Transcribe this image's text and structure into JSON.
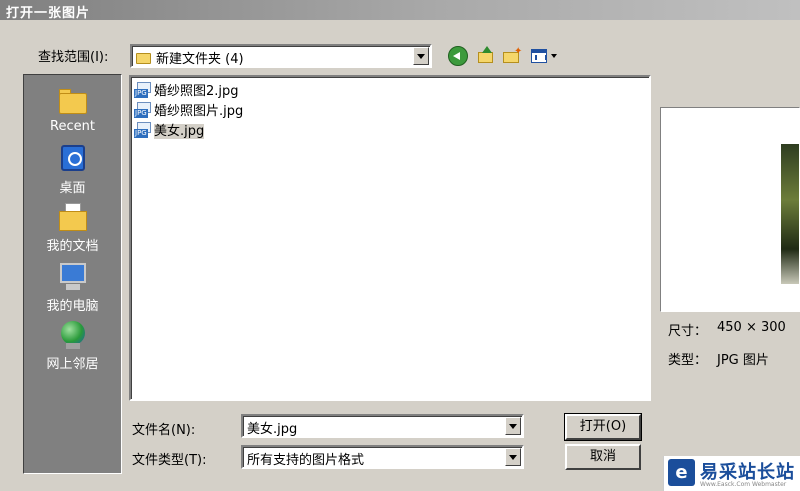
{
  "window": {
    "title": "打开一张图片"
  },
  "look_in": {
    "label": "查找范围(I):",
    "value": "新建文件夹 (4)"
  },
  "toolbar": [
    "back-icon",
    "up-folder-icon",
    "new-folder-icon",
    "views-menu-icon"
  ],
  "places": [
    {
      "icon": "recent-folder-icon",
      "label": "Recent"
    },
    {
      "icon": "desktop-icon",
      "label": "桌面"
    },
    {
      "icon": "my-documents-icon",
      "label": "我的文档"
    },
    {
      "icon": "my-computer-icon",
      "label": "我的电脑"
    },
    {
      "icon": "network-icon",
      "label": "网上邻居"
    }
  ],
  "files": [
    {
      "name": "婚纱照图2.jpg",
      "selected": false
    },
    {
      "name": "婚纱照图片.jpg",
      "selected": false
    },
    {
      "name": "美女.jpg",
      "selected": true
    }
  ],
  "file_icon_tag": "JPG",
  "info": {
    "size_label": "尺寸：",
    "size_value": "450 × 300",
    "type_label": "类型：",
    "type_value": "JPG 图片"
  },
  "filename": {
    "label": "文件名(N):",
    "value": "美女.jpg"
  },
  "filetype": {
    "label": "文件类型(T):",
    "value": "所有支持的图片格式"
  },
  "buttons": {
    "open": "打开(O)",
    "cancel": "取消"
  },
  "watermark": {
    "logo": "e",
    "text": "易采站长站",
    "sub": "Www.Easck.Com Webmaster"
  },
  "colors": {
    "dialog_bg": "#d4d0c8",
    "places_bg": "#808080",
    "brand": "#1b4e9b"
  }
}
